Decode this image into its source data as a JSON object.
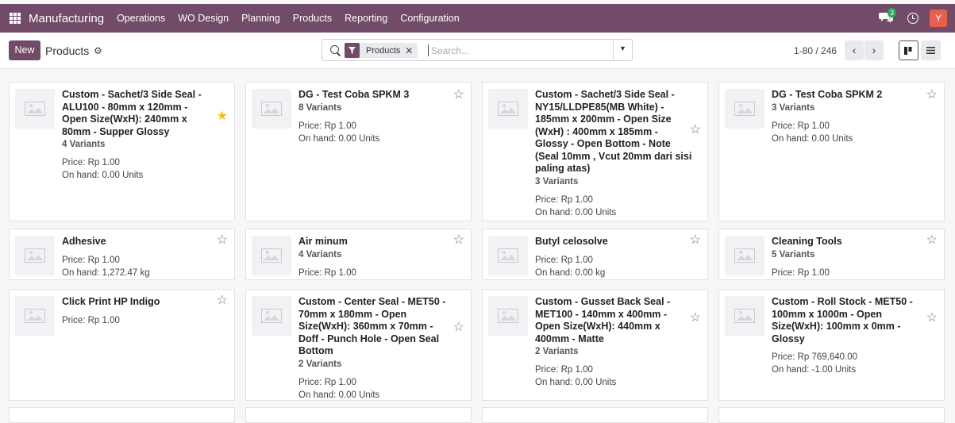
{
  "navbar": {
    "app_name": "Manufacturing",
    "menu": [
      "Operations",
      "WO Design",
      "Planning",
      "Products",
      "Reporting",
      "Configuration"
    ],
    "chat_badge": "3",
    "avatar_initial": "Y"
  },
  "control": {
    "new_label": "New",
    "title": "Products",
    "filter_facet": "Products",
    "search_placeholder": "Search...",
    "pager": "1-80 / 246"
  },
  "icons": {
    "apps": "apps-grid-icon",
    "chat": "chat-icon",
    "clock": "clock-icon",
    "gear": "gear-icon",
    "search": "search-icon",
    "filter": "filter-icon",
    "star": "star-icon",
    "placeholder_image": "image-placeholder-icon"
  },
  "colors": {
    "brand": "#714b67",
    "favorite_star": "#f3c00e",
    "badge": "#1faa59",
    "avatar": "#e6604d"
  },
  "products": [
    {
      "name": "Custom - Sachet/3 Side Seal - ALU100 - 80mm x 120mm - Open Size(WxH): 240mm x 80mm - Supper Glossy",
      "variants": "4 Variants",
      "price": "Price: Rp 1.00",
      "on_hand": "On hand: 0.00 Units",
      "favorite": true
    },
    {
      "name": "DG - Test Coba SPKM 3",
      "variants": "8 Variants",
      "price": "Price: Rp 1.00",
      "on_hand": "On hand: 0.00 Units",
      "favorite": false
    },
    {
      "name": "Custom - Sachet/3 Side Seal - NY15/LLDPE85(MB White) - 185mm x 200mm - Open Size (WxH) : 400mm x 185mm - Glossy - Open Bottom - Note (Seal 10mm , Vcut 20mm dari sisi paling atas)",
      "variants": "3 Variants",
      "price": "Price: Rp 1.00",
      "on_hand": "On hand: 0.00 Units",
      "favorite": false
    },
    {
      "name": "DG - Test Coba SPKM 2",
      "variants": "3 Variants",
      "price": "Price: Rp 1.00",
      "on_hand": "On hand: 0.00 Units",
      "favorite": false
    },
    {
      "name": "Adhesive",
      "variants": null,
      "price": "Price: Rp 1.00",
      "on_hand": "On hand: 1,272.47 kg",
      "favorite": false
    },
    {
      "name": "Air minum",
      "variants": "4 Variants",
      "price": "Price: Rp 1.00",
      "on_hand": null,
      "favorite": false
    },
    {
      "name": "Butyl celosolve",
      "variants": null,
      "price": "Price: Rp 1.00",
      "on_hand": "On hand: 0.00 kg",
      "favorite": false
    },
    {
      "name": "Cleaning Tools",
      "variants": "5 Variants",
      "price": "Price: Rp 1.00",
      "on_hand": null,
      "favorite": false
    },
    {
      "name": "Click Print HP Indigo",
      "variants": null,
      "price": "Price: Rp 1.00",
      "on_hand": null,
      "favorite": false
    },
    {
      "name": "Custom - Center Seal - MET50 - 70mm x 180mm - Open Size(WxH): 360mm x 70mm - Doff - Punch Hole - Open Seal Bottom",
      "variants": "2 Variants",
      "price": "Price: Rp 1.00",
      "on_hand": "On hand: 0.00 Units",
      "favorite": false
    },
    {
      "name": "Custom - Gusset Back Seal - MET100 - 140mm x 400mm - Open Size(WxH): 440mm x 400mm - Matte",
      "variants": "2 Variants",
      "price": "Price: Rp 1.00",
      "on_hand": "On hand: 0.00 Units",
      "favorite": false
    },
    {
      "name": "Custom - Roll Stock - MET50 - 100mm x 1000m - Open Size(WxH): 100mm x 0mm - Glossy",
      "variants": null,
      "price": "Price: Rp 769,640.00",
      "on_hand": "On hand: -1.00 Units",
      "favorite": false
    }
  ]
}
